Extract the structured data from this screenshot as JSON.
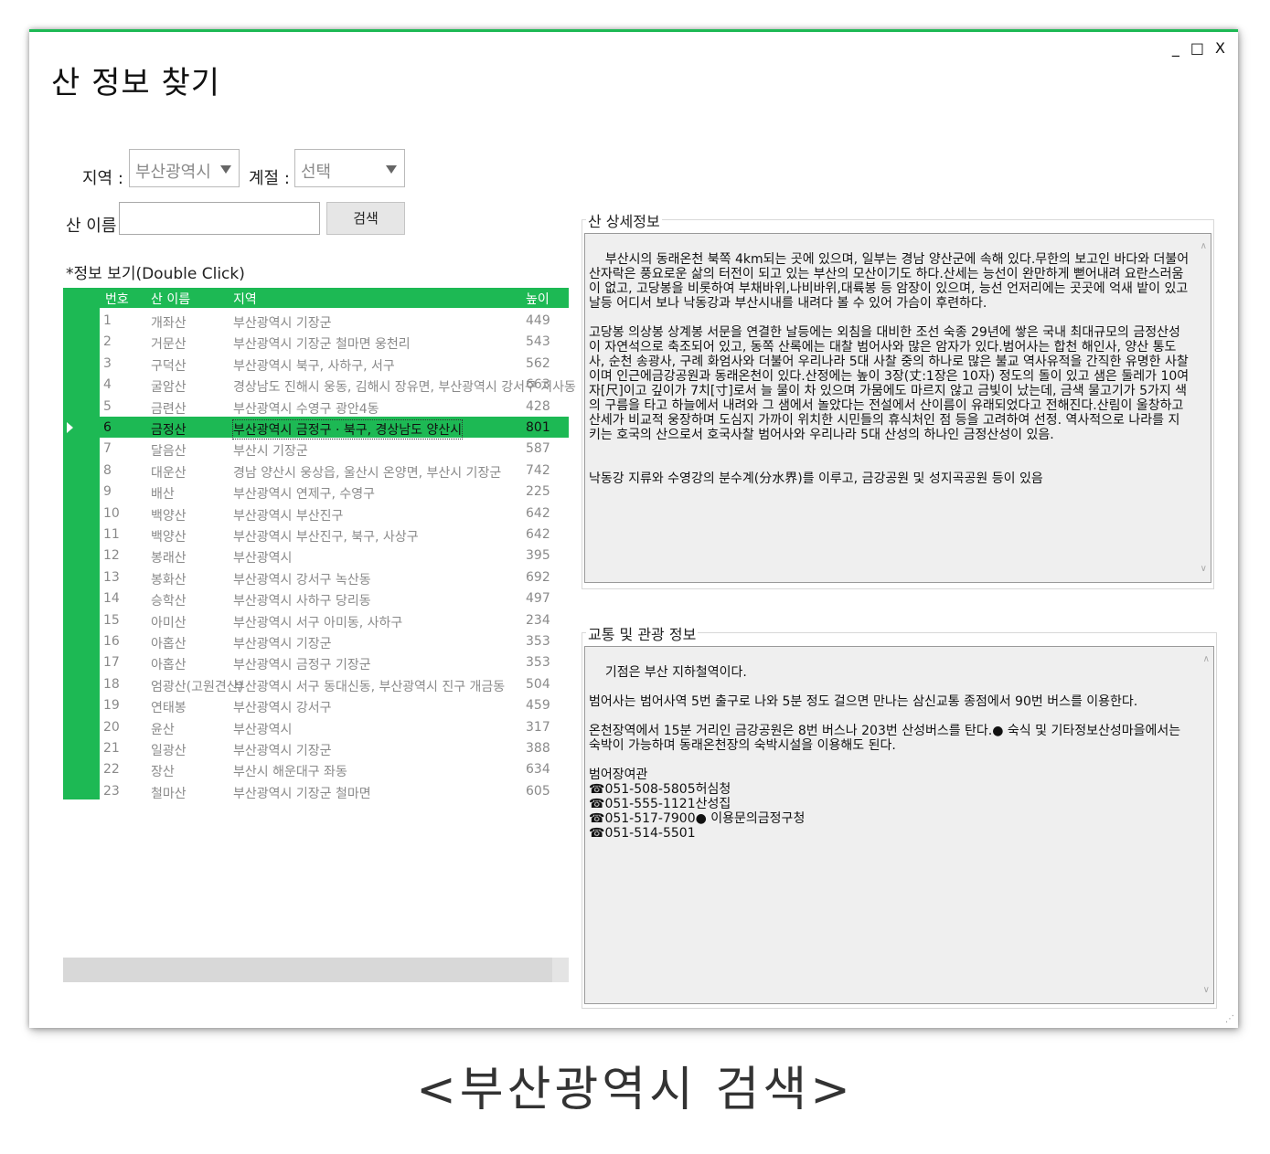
{
  "window": {
    "title": "산 정보 찾기",
    "controls": {
      "minimize": "_",
      "maximize": "□",
      "close": "X"
    }
  },
  "filters": {
    "region_label": "지역 :",
    "region_value": "부산광역시",
    "season_label": "계절 :",
    "season_value": "선택",
    "name_label": "산 이름 :",
    "name_value": "",
    "search_button": "검색"
  },
  "list": {
    "caption": "*정보 보기(Double Click)",
    "columns": {
      "no": "번호",
      "name": "산 이름",
      "region": "지역",
      "height": "높이(m)"
    },
    "selected_index": 5,
    "rows": [
      {
        "no": "1",
        "name": "개좌산",
        "region": "부산광역시 기장군",
        "height": "449"
      },
      {
        "no": "2",
        "name": "거문산",
        "region": "부산광역시 기장군 철마면 웅천리",
        "height": "543"
      },
      {
        "no": "3",
        "name": "구덕산",
        "region": "부산광역시 북구, 사하구, 서구",
        "height": "562"
      },
      {
        "no": "4",
        "name": "굴암산",
        "region": "경상남도 진해시 웅동, 김해시 장유면, 부산광역시 강서구 지사동",
        "height": "663"
      },
      {
        "no": "5",
        "name": "금련산",
        "region": "부산광역시 수영구 광안4동",
        "height": "428"
      },
      {
        "no": "6",
        "name": "금정산",
        "region": "부산광역시 금정구 · 북구, 경상남도 양산시",
        "height": "801"
      },
      {
        "no": "7",
        "name": "달음산",
        "region": "부산시 기장군",
        "height": "587"
      },
      {
        "no": "8",
        "name": "대운산",
        "region": "경남 양산시 웅상읍, 울산시 온양면, 부산시 기장군",
        "height": "742"
      },
      {
        "no": "9",
        "name": "배산",
        "region": "부산광역시 연제구, 수영구",
        "height": "225"
      },
      {
        "no": "10",
        "name": "백양산",
        "region": "부산광역시 부산진구",
        "height": "642"
      },
      {
        "no": "11",
        "name": "백양산",
        "region": "부산광역시 부산진구, 북구, 사상구",
        "height": "642"
      },
      {
        "no": "12",
        "name": "봉래산",
        "region": "부산광역시",
        "height": "395"
      },
      {
        "no": "13",
        "name": "봉화산",
        "region": "부산광역시 강서구 녹산동",
        "height": "692"
      },
      {
        "no": "14",
        "name": "승학산",
        "region": "부산광역시 사하구 당리동",
        "height": "497"
      },
      {
        "no": "15",
        "name": "아미산",
        "region": "부산광역시 서구 아미동, 사하구",
        "height": "234"
      },
      {
        "no": "16",
        "name": "아홉산",
        "region": "부산광역시 기장군",
        "height": "353"
      },
      {
        "no": "17",
        "name": "아홉산",
        "region": "부산광역시 금정구 기장군",
        "height": "353"
      },
      {
        "no": "18",
        "name": "엄광산(고원견산)",
        "region": "부산광역시 서구 동대신동, 부산광역시 진구 개금동",
        "height": "504"
      },
      {
        "no": "19",
        "name": "연태봉",
        "region": "부산광역시 강서구",
        "height": "459"
      },
      {
        "no": "20",
        "name": "윤산",
        "region": "부산광역시",
        "height": "317"
      },
      {
        "no": "21",
        "name": "일광산",
        "region": "부산광역시 기장군",
        "height": "388"
      },
      {
        "no": "22",
        "name": "장산",
        "region": "부산시 해운대구 좌동",
        "height": "634"
      },
      {
        "no": "23",
        "name": "철마산",
        "region": "부산광역시 기장군 철마면",
        "height": "605"
      }
    ]
  },
  "detail": {
    "title": "산 상세정보",
    "text": "부산시의 동래온천 북쪽 4km되는 곳에 있으며, 일부는 경남 양산군에 속해 있다.무한의 보고인 바다와 더불어 산자락은 풍요로운 삶의 터전이 되고 있는 부산의 모산이기도 하다.산세는 능선이 완만하게 뻗어내려 요란스러움이 없고, 고당봉을 비롯하여 부채바위,나비바위,대륙봉 등 암장이 있으며, 능선 언저리에는 곳곳에 억새 밭이 있고 날등 어디서 보나 낙동강과 부산시내를 내려다 볼 수 있어 가슴이 후련하다.\n\n고당봉 의상봉 상계봉 서문을 연결한 날등에는 외침을 대비한 조선 숙종 29년에 쌓은 국내 최대규모의 금정산성이 자연석으로 축조되어 있고, 동쪽 산록에는 대찰 범어사와 많은 암자가 있다.범어사는 합천 해인사, 양산 통도사, 순천 송광사, 구례 화엄사와 더불어 우리나라 5대 사찰 중의 하나로 많은 불교 역사유적을 간직한 유명한 사찰이며 인근에금강공원과 동래온천이 있다.산정에는 높이 3장(丈:1장은 10자) 정도의 돌이 있고 샘은 둘레가 10여 자[尺]이고 깊이가 7치[寸]로서 늘 물이 차 있으며 가뭄에도 마르지 않고 금빛이 났는데, 금색 물고기가 5가지 색의 구름을 타고 하늘에서 내려와 그 샘에서 놀았다는 전설에서 산이름이 유래되었다고 전해진다.산림이 울창하고 산세가 비교적 웅장하며 도심지 가까이 위치한 시민들의 휴식처인 점 등을 고려하여 선정. 역사적으로 나라를 지키는 호국의 산으로서 호국사찰 범어사와 우리나라 5대 산성의 하나인 금정산성이 있음.\n\n\n낙동강 지류와 수영강의 분수계(分水界)를 이루고, 금강공원 및 성지곡공원 등이 있음"
  },
  "transport": {
    "title": "교통 및 관광 정보",
    "text": "기점은 부산 지하철역이다.\n\n범어사는 범어사역 5번 출구로 나와 5분 정도 걸으면 만나는 삼신교통 종점에서 90번 버스를 이용한다.\n\n온천장역에서 15분 거리인 금강공원은 8번 버스나 203번 산성버스를 탄다.● 숙식 및 기타정보산성마을에서는 숙박이 가능하며 동래온천장의 숙박시설을 이용해도 된다.\n\n범어장여관\n☎051-508-5805허심청\n☎051-555-1121산성집\n☎051-517-7900● 이용문의금정구청\n☎051-514-5501"
  },
  "caption": "<부산광역시 검색>"
}
